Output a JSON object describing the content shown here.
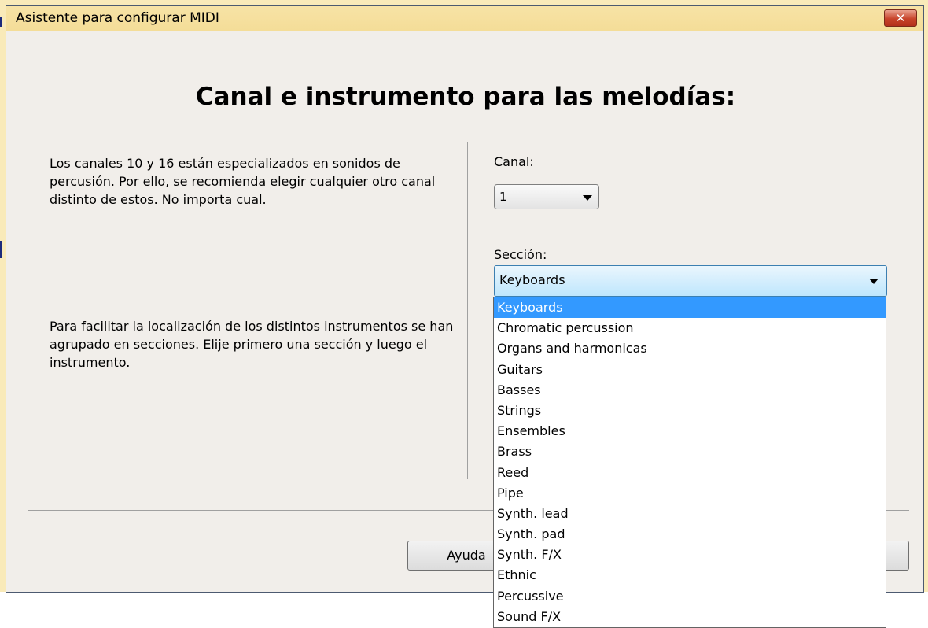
{
  "window": {
    "title": "Asistente para configurar MIDI",
    "close_glyph": "✕"
  },
  "heading": "Canal e instrumento para las melodías:",
  "info": {
    "channels_text": "Los canales 10 y 16 están especializados en sonidos de percusión. Por ello, se recomienda elegir cualquier otro canal distinto de estos. No importa cual.",
    "sections_text": "Para facilitar la localización de los distintos instrumentos se han agrupado en secciones. Elije primero una sección y luego el instrumento."
  },
  "canal": {
    "label": "Canal:",
    "value": "1"
  },
  "seccion": {
    "label": "Sección:",
    "value": "Keyboards",
    "options": [
      "Keyboards",
      "Chromatic percussion",
      "Organs and harmonicas",
      "Guitars",
      "Basses",
      "Strings",
      "Ensembles",
      "Brass",
      "Reed",
      "Pipe",
      "Synth. lead",
      "Synth. pad",
      "Synth. F/X",
      "Ethnic",
      "Percussive",
      "Sound F/X"
    ],
    "selected_index": 0
  },
  "buttons": {
    "help_label": "Ayuda"
  },
  "colors": {
    "highlight": "#3399ff",
    "titlebar": "#f5df9d",
    "window_bg": "#f1eeea",
    "close_button": "#c7432a"
  }
}
